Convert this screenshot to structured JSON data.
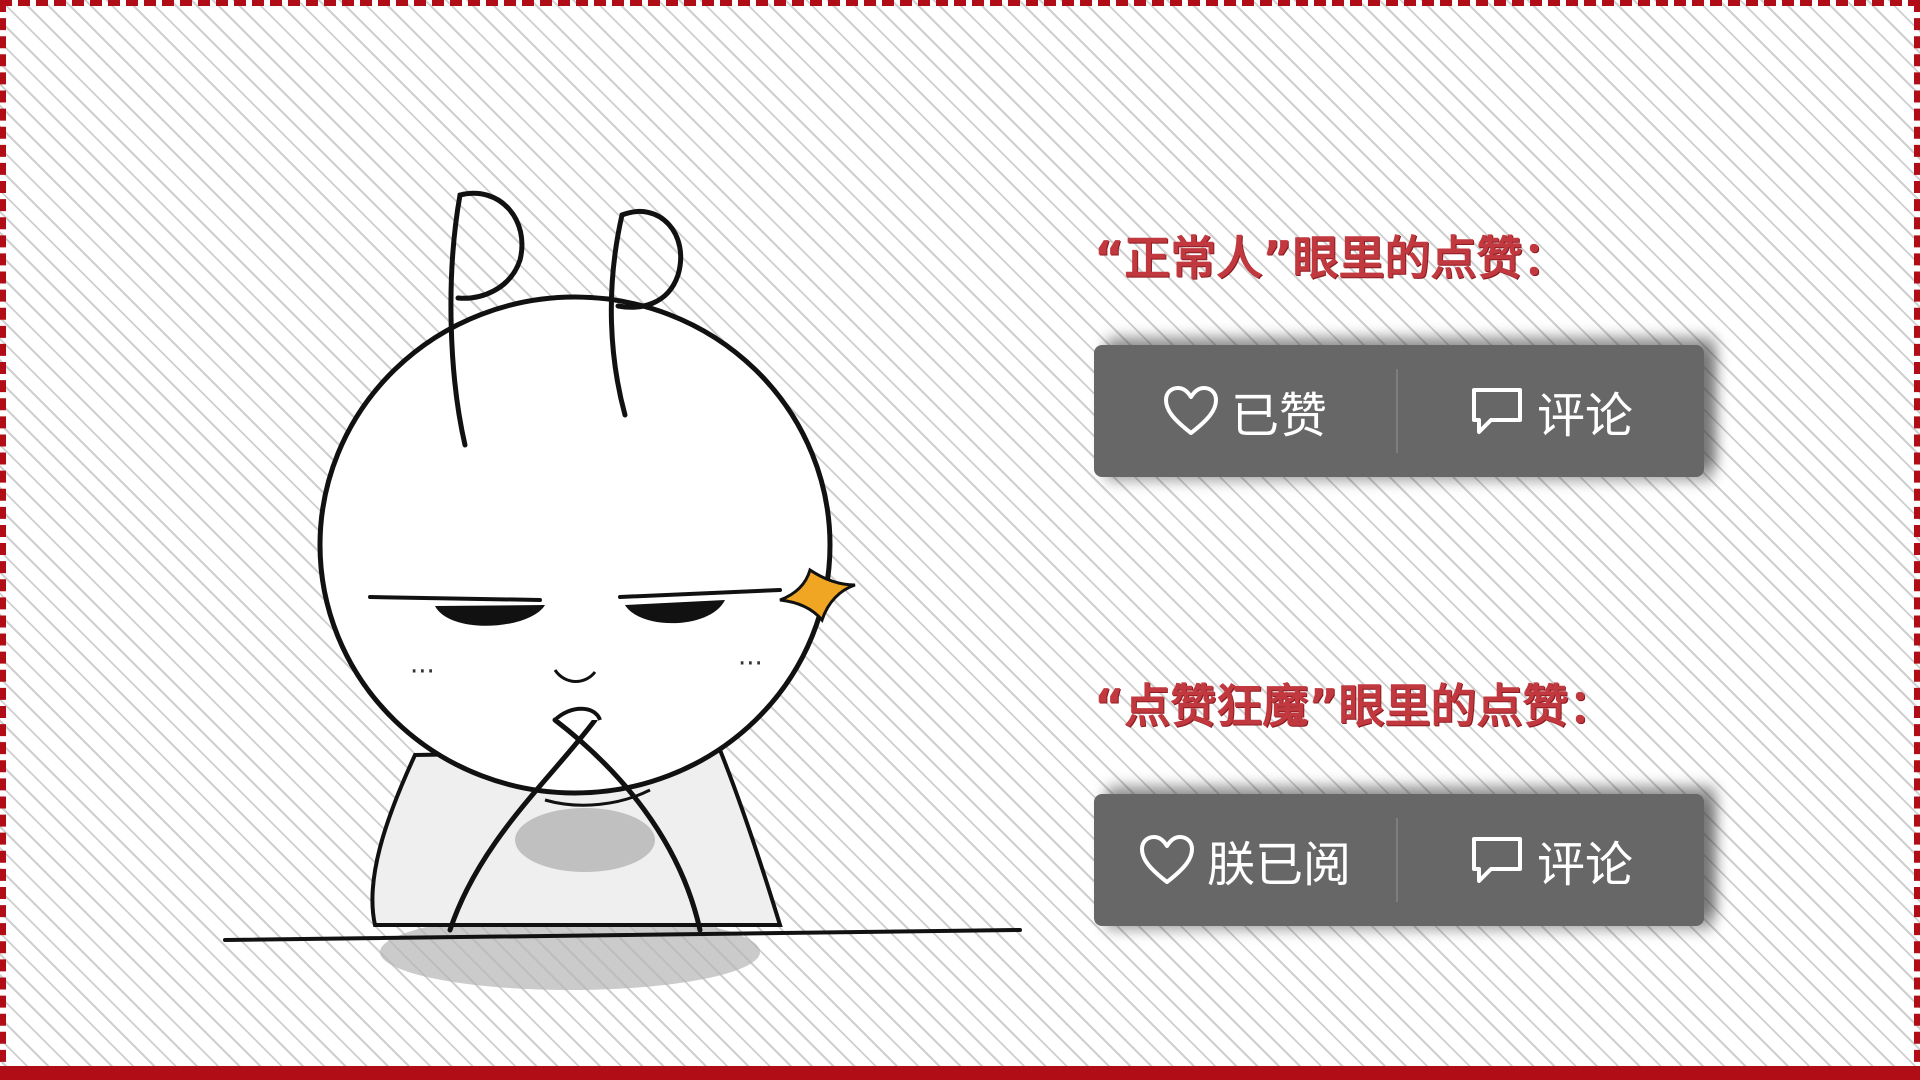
{
  "sections": [
    {
      "heading": "“正常人”眼里的点赞：",
      "like_label": "已赞",
      "like_icon": "heart-icon",
      "comment_label": "评论",
      "comment_icon": "comment-bubble-icon"
    },
    {
      "heading": "“点赞狂魔”眼里的点赞：",
      "like_label": "朕已阅",
      "like_icon": "heart-icon",
      "comment_label": "评论",
      "comment_icon": "comment-bubble-icon"
    }
  ],
  "colors": {
    "frame": "#b00d16",
    "heading": "#c1393f",
    "bar": "#676767",
    "accent_star": "#f0a623"
  }
}
